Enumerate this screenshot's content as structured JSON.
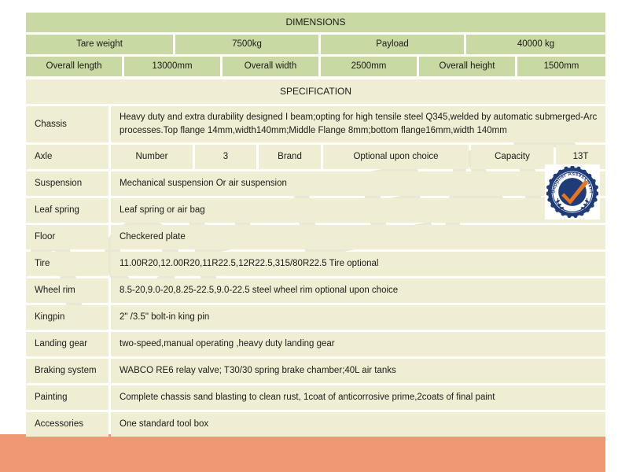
{
  "watermark": {
    "text": "TOP LEAD"
  },
  "colors": {
    "dimensions_cell": "#c9d9a3",
    "specification_cell": "#efeed3",
    "footer_bar": "#ef9873",
    "badge_navy": "#1f3c78",
    "badge_check": "#e8761f",
    "page_background": "#ffffff"
  },
  "dimensions": {
    "title": "DIMENSIONS",
    "rows": [
      {
        "cells": [
          {
            "label": "Tare weight",
            "value": "7500kg"
          },
          {
            "label": "Payload",
            "value": "40000 kg"
          }
        ]
      },
      {
        "cells": [
          {
            "label": "Overall length",
            "value": "13000mm"
          },
          {
            "label": "Overall width",
            "value": "2500mm"
          },
          {
            "label": "Overall height",
            "value": "1500mm"
          }
        ]
      }
    ],
    "row1": {
      "c1": "Tare weight",
      "c2": "7500kg",
      "c3": "Payload",
      "c4": "40000 kg"
    },
    "row2": {
      "c1": "Overall length",
      "c2": "13000mm",
      "c3": "Overall width",
      "c4": "2500mm",
      "c5": "Overall height",
      "c6": "1500mm"
    }
  },
  "specification": {
    "title": "SPECIFICATION",
    "chassis": {
      "label": "Chassis",
      "value": "Heavy duty and extra durability designed I beam;opting for high tensile steel Q345,welded by automatic submerged-Arc processes.Top flange 14mm,width140mm;Middle Flange 8mm;bottom flange16mm,width 140mm"
    },
    "axle": {
      "label": "Axle",
      "number_label": "Number",
      "number_value": "3",
      "brand_label": "Brand",
      "brand_value": "Optional upon choice",
      "capacity_label": "Capacity",
      "capacity_value": "13T"
    },
    "rows": [
      {
        "label": "Suspension",
        "value": "Mechanical suspension Or air suspension"
      },
      {
        "label": "Leaf spring",
        "value": "Leaf spring or air bag"
      },
      {
        "label": "Floor",
        "value": "Checkered plate"
      },
      {
        "label": "Tire",
        "value": "11.00R20,12.00R20,11R22.5,12R22.5,315/80R22.5 Tire optional"
      },
      {
        "label": "Wheel rim",
        "value": "8.5-20,9.0-20,8.25-22.5,9.0-22.5 steel wheel rim optional upon choice"
      },
      {
        "label": "Kingpin",
        "value": "2\" /3.5\" bolt-in king pin"
      },
      {
        "label": "Landing gear",
        "value": "two-speed,manual operating ,heavy duty landing gear"
      },
      {
        "label": "Braking system",
        "value": "WABCO RE6 relay valve; T30/30 spring brake chamber;40L air tanks"
      },
      {
        "label": "Painting",
        "value": "Complete chassis sand blasting to clean rust, 1coat of anticorrosive prime,2coats of final paint"
      },
      {
        "label": "Accessories",
        "value": "One standard tool box"
      }
    ]
  },
  "badge": {
    "name": "supplier-assessment-seal",
    "text": "Supplier Assessment"
  }
}
